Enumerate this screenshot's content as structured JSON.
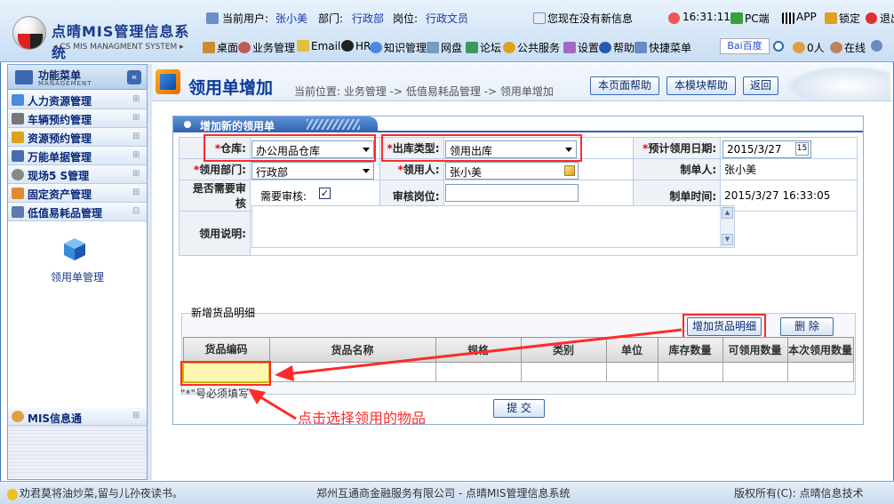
{
  "app": {
    "title": "点晴MIS管理信息系统",
    "subtitle": "◂ CS MIS MANAGMENT SYSTEM ▸"
  },
  "userbar": {
    "user_label": "当前用户:",
    "user_value": "张小美",
    "dept_label": "部门:",
    "dept_value": "行政部",
    "post_label": "岗位:",
    "post_value": "行政文员",
    "message": "您现在没有新信息",
    "time": "16:31:11",
    "pc": "PC端",
    "app": "APP",
    "lock": "锁定",
    "logout": "退出"
  },
  "nav": {
    "items": [
      "桌面",
      "业务管理",
      "Email",
      "HR",
      "知识管理",
      "网盘",
      "论坛",
      "公共服务",
      "设置",
      "帮助",
      "快捷菜单"
    ],
    "search_logo": "Bai百度",
    "online_count": "0人",
    "online_label": "在线"
  },
  "sidebar": {
    "title": "功能菜单",
    "title_sub": "MANAGEMENT",
    "items": [
      "人力资源管理",
      "车辆预约管理",
      "资源预约管理",
      "万能单据管理",
      "现场5 S管理",
      "固定资产管理",
      "低值易耗品管理"
    ],
    "module_label": "领用单管理",
    "info_title": "MIS信息通"
  },
  "page": {
    "title": "领用单增加",
    "breadcrumb": "当前位置: 业务管理 -> 低值易耗品管理 -> 领用单增加",
    "buttons": [
      "本页面帮助",
      "本模块帮助",
      "返回"
    ]
  },
  "form": {
    "panel_title": "增加新的领用单",
    "warehouse_label": "仓库:",
    "warehouse_value": "办公用品仓库",
    "out_type_label": "出库类型:",
    "out_type_value": "领用出库",
    "expect_date_label": "预计领用日期:",
    "expect_date_value": "2015/3/27",
    "dept_label": "领用部门:",
    "dept_value": "行政部",
    "receiver_label": "领用人:",
    "receiver_value": "张小美",
    "maker_label": "制单人:",
    "maker_value": "张小美",
    "need_review_label": "是否需要审核",
    "need_review_text": "需要审核:",
    "review_post_label": "审核岗位:",
    "review_post_value": "",
    "make_time_label": "制单时间:",
    "make_time_value": "2015/3/27 16:33:05",
    "desc_label": "领用说明:",
    "desc_value": "",
    "detail_label": "新增货品明细",
    "add_detail_button": "增加货品明细",
    "delete_button": "删 除",
    "columns": [
      "货品编码",
      "货品名称",
      "规格",
      "类别",
      "单位",
      "库存数量",
      "可领用数量",
      "本次领用数量"
    ],
    "required_note": "\"*\"号必须填写",
    "submit_button": "提 交"
  },
  "annotation": "点击选择领用的物品",
  "footer": {
    "motto": "劝君莫将油炒菜,留与儿孙夜读书。",
    "company": "郑州互通商金融服务有限公司 - 点晴MIS管理信息系统",
    "copyright": "版权所有(C): 点晴信息技术"
  },
  "colors": {
    "accent": "#0a3a9a",
    "highlight": "#ff2a2a",
    "selected_cell": "#fff7b0"
  }
}
